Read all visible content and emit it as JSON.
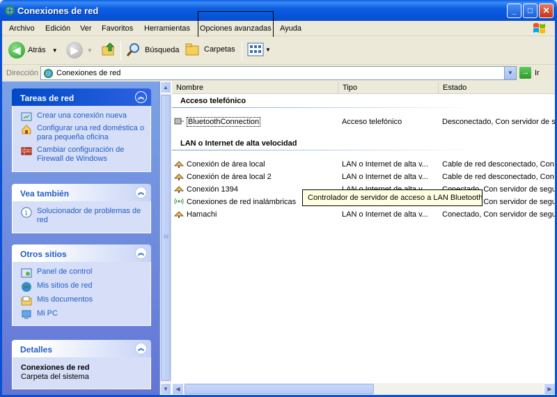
{
  "window": {
    "title": "Conexiones de red",
    "minimize_label": "_",
    "maximize_label": "□",
    "close_label": "✕"
  },
  "menu": {
    "items": [
      "Archivo",
      "Edición",
      "Ver",
      "Favoritos",
      "Herramientas",
      "Opciones avanzadas",
      "Ayuda"
    ]
  },
  "toolbar": {
    "back_label": "Atrás",
    "search_label": "Búsqueda",
    "folders_label": "Carpetas"
  },
  "address": {
    "label": "Dirección",
    "value": "Conexiones de red",
    "go_label": "Ir"
  },
  "sidebar": {
    "network_tasks": {
      "title": "Tareas de red",
      "items": [
        "Crear una conexión nueva",
        "Configurar una red doméstica o para pequeña oficina",
        "Cambiar configuración de Firewall de Windows"
      ]
    },
    "see_also": {
      "title": "Vea también",
      "items": [
        "Solucionador de problemas de red"
      ]
    },
    "other_places": {
      "title": "Otros sitios",
      "items": [
        "Panel de control",
        "Mis sitios de red",
        "Mis documentos",
        "Mi PC"
      ]
    },
    "details": {
      "title": "Detalles",
      "name": "Conexiones de red",
      "subtitle": "Carpeta del sistema"
    }
  },
  "list": {
    "columns": [
      "Nombre",
      "Tipo",
      "Estado"
    ],
    "groups": [
      {
        "title": "Acceso telefónico",
        "rows": [
          {
            "name": "BluetoothConnection",
            "type": "Acceso telefónico",
            "state": "Desconectado, Con servidor de se"
          }
        ]
      },
      {
        "title": "LAN o Internet de alta velocidad",
        "rows": [
          {
            "name": "Conexión de área local",
            "type": "LAN o Internet de alta v...",
            "state": "Cable de red desconectado, Con s"
          },
          {
            "name": "Conexión de área local 2",
            "type": "LAN o Internet de alta v...",
            "state": "Cable de red desconectado, Con s"
          },
          {
            "name": "Conexión 1394",
            "type": "LAN o Internet de alta v...",
            "state": "Conectado, Con servidor de segu"
          },
          {
            "name": "Conexiones de red inalámbricas",
            "type": "LAN o Internet de alta v...",
            "state": "Conectado, Con servidor de segu"
          },
          {
            "name": "Hamachi",
            "type": "LAN o Internet de alta v...",
            "state": "Conectado, Con servidor de segu"
          }
        ]
      }
    ]
  },
  "tooltip": {
    "text": "Controlador de servidor de acceso a LAN Bluetooth"
  }
}
